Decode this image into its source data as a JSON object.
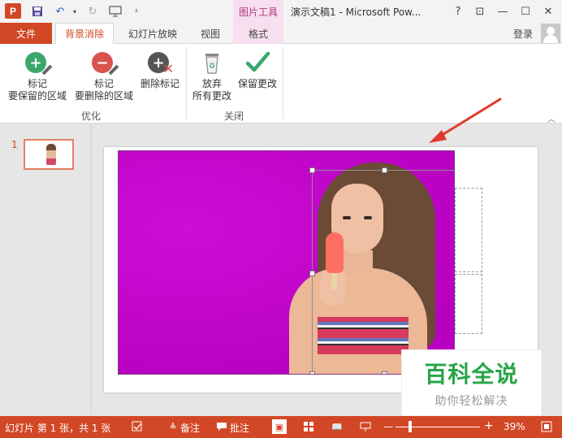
{
  "titlebar": {
    "logo_letter": "P",
    "context_tab": "图片工具",
    "doc_title": "演示文稿1 - Microsoft Pow...",
    "help": "?",
    "ribbon_display": "⊡",
    "minimize": "—",
    "maximize": "☐",
    "close": "✕"
  },
  "tabs": {
    "file": "文件",
    "background_removal": "背景消除",
    "slideshow": "幻灯片放映",
    "view": "视图",
    "format": "格式",
    "login": "登录"
  },
  "ribbon": {
    "mark_keep_line1": "标记",
    "mark_keep_line2": "要保留的区域",
    "mark_remove_line1": "标记",
    "mark_remove_line2": "要删除的区域",
    "delete_mark": "删除标记",
    "discard_line1": "放弃",
    "discard_line2": "所有更改",
    "keep_changes": "保留更改",
    "group_refine": "优化",
    "group_close": "关闭"
  },
  "slides_panel": {
    "slide_number": "1"
  },
  "watermark": {
    "title": "百科全说",
    "subtitle": "助你轻松解决"
  },
  "statusbar": {
    "slide_info": "幻灯片 第 1 张，共 1 张",
    "notes": "备注",
    "comments": "批注",
    "zoom_minus": "—",
    "zoom_plus": "+",
    "zoom": "39%"
  },
  "colors": {
    "accent": "#d24726",
    "removal_magenta": "#c009c9",
    "watermark_green": "#27a548"
  }
}
